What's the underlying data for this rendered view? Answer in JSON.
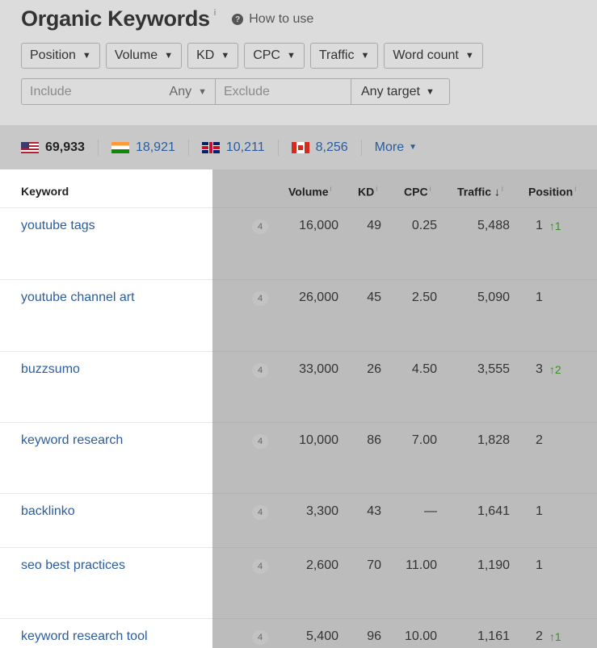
{
  "header": {
    "title": "Organic Keywords",
    "title_info": "i",
    "how_to_use": "How to use",
    "how_to_icon": "?"
  },
  "filters": [
    {
      "label": "Position",
      "caret": "▼"
    },
    {
      "label": "Volume",
      "caret": "▼"
    },
    {
      "label": "KD",
      "caret": "▼"
    },
    {
      "label": "CPC",
      "caret": "▼"
    },
    {
      "label": "Traffic",
      "caret": "▼"
    },
    {
      "label": "Word count",
      "caret": "▼"
    }
  ],
  "search": {
    "include_placeholder": "Include",
    "any_label": "Any",
    "exclude_placeholder": "Exclude",
    "target_label": "Any target",
    "caret": "▼"
  },
  "countries": [
    {
      "flag": "us-flag-icon",
      "value": "69,933"
    },
    {
      "flag": "india-flag-icon",
      "value": "18,921"
    },
    {
      "flag": "uk-flag-icon",
      "value": "10,211"
    },
    {
      "flag": "canada-flag-icon",
      "value": "8,256"
    }
  ],
  "more": {
    "label": "More",
    "caret": "▼"
  },
  "columns": {
    "keyword": "Keyword",
    "volume": "Volume",
    "kd": "KD",
    "cpc": "CPC",
    "traffic": "Traffic",
    "traffic_sort": "↓",
    "position": "Position",
    "info": "i"
  },
  "rows": [
    {
      "keyword": "youtube tags",
      "badge": "4",
      "volume": "16,000",
      "kd": "49",
      "cpc": "0.25",
      "traffic": "5,488",
      "position": "1",
      "change": "↑1"
    },
    {
      "keyword": "youtube channel art",
      "badge": "4",
      "volume": "26,000",
      "kd": "45",
      "cpc": "2.50",
      "traffic": "5,090",
      "position": "1",
      "change": ""
    },
    {
      "keyword": "buzzsumo",
      "badge": "4",
      "volume": "33,000",
      "kd": "26",
      "cpc": "4.50",
      "traffic": "3,555",
      "position": "3",
      "change": "↑2"
    },
    {
      "keyword": "keyword research",
      "badge": "4",
      "volume": "10,000",
      "kd": "86",
      "cpc": "7.00",
      "traffic": "1,828",
      "position": "2",
      "change": ""
    },
    {
      "keyword": "backlinko",
      "badge": "4",
      "volume": "3,300",
      "kd": "43",
      "cpc": "—",
      "traffic": "1,641",
      "position": "1",
      "change": ""
    },
    {
      "keyword": "seo best practices",
      "badge": "4",
      "volume": "2,600",
      "kd": "70",
      "cpc": "11.00",
      "traffic": "1,190",
      "position": "1",
      "change": ""
    },
    {
      "keyword": "keyword research tool",
      "badge": "4",
      "volume": "5,400",
      "kd": "96",
      "cpc": "10.00",
      "traffic": "1,161",
      "position": "2",
      "change": "↑1"
    }
  ]
}
